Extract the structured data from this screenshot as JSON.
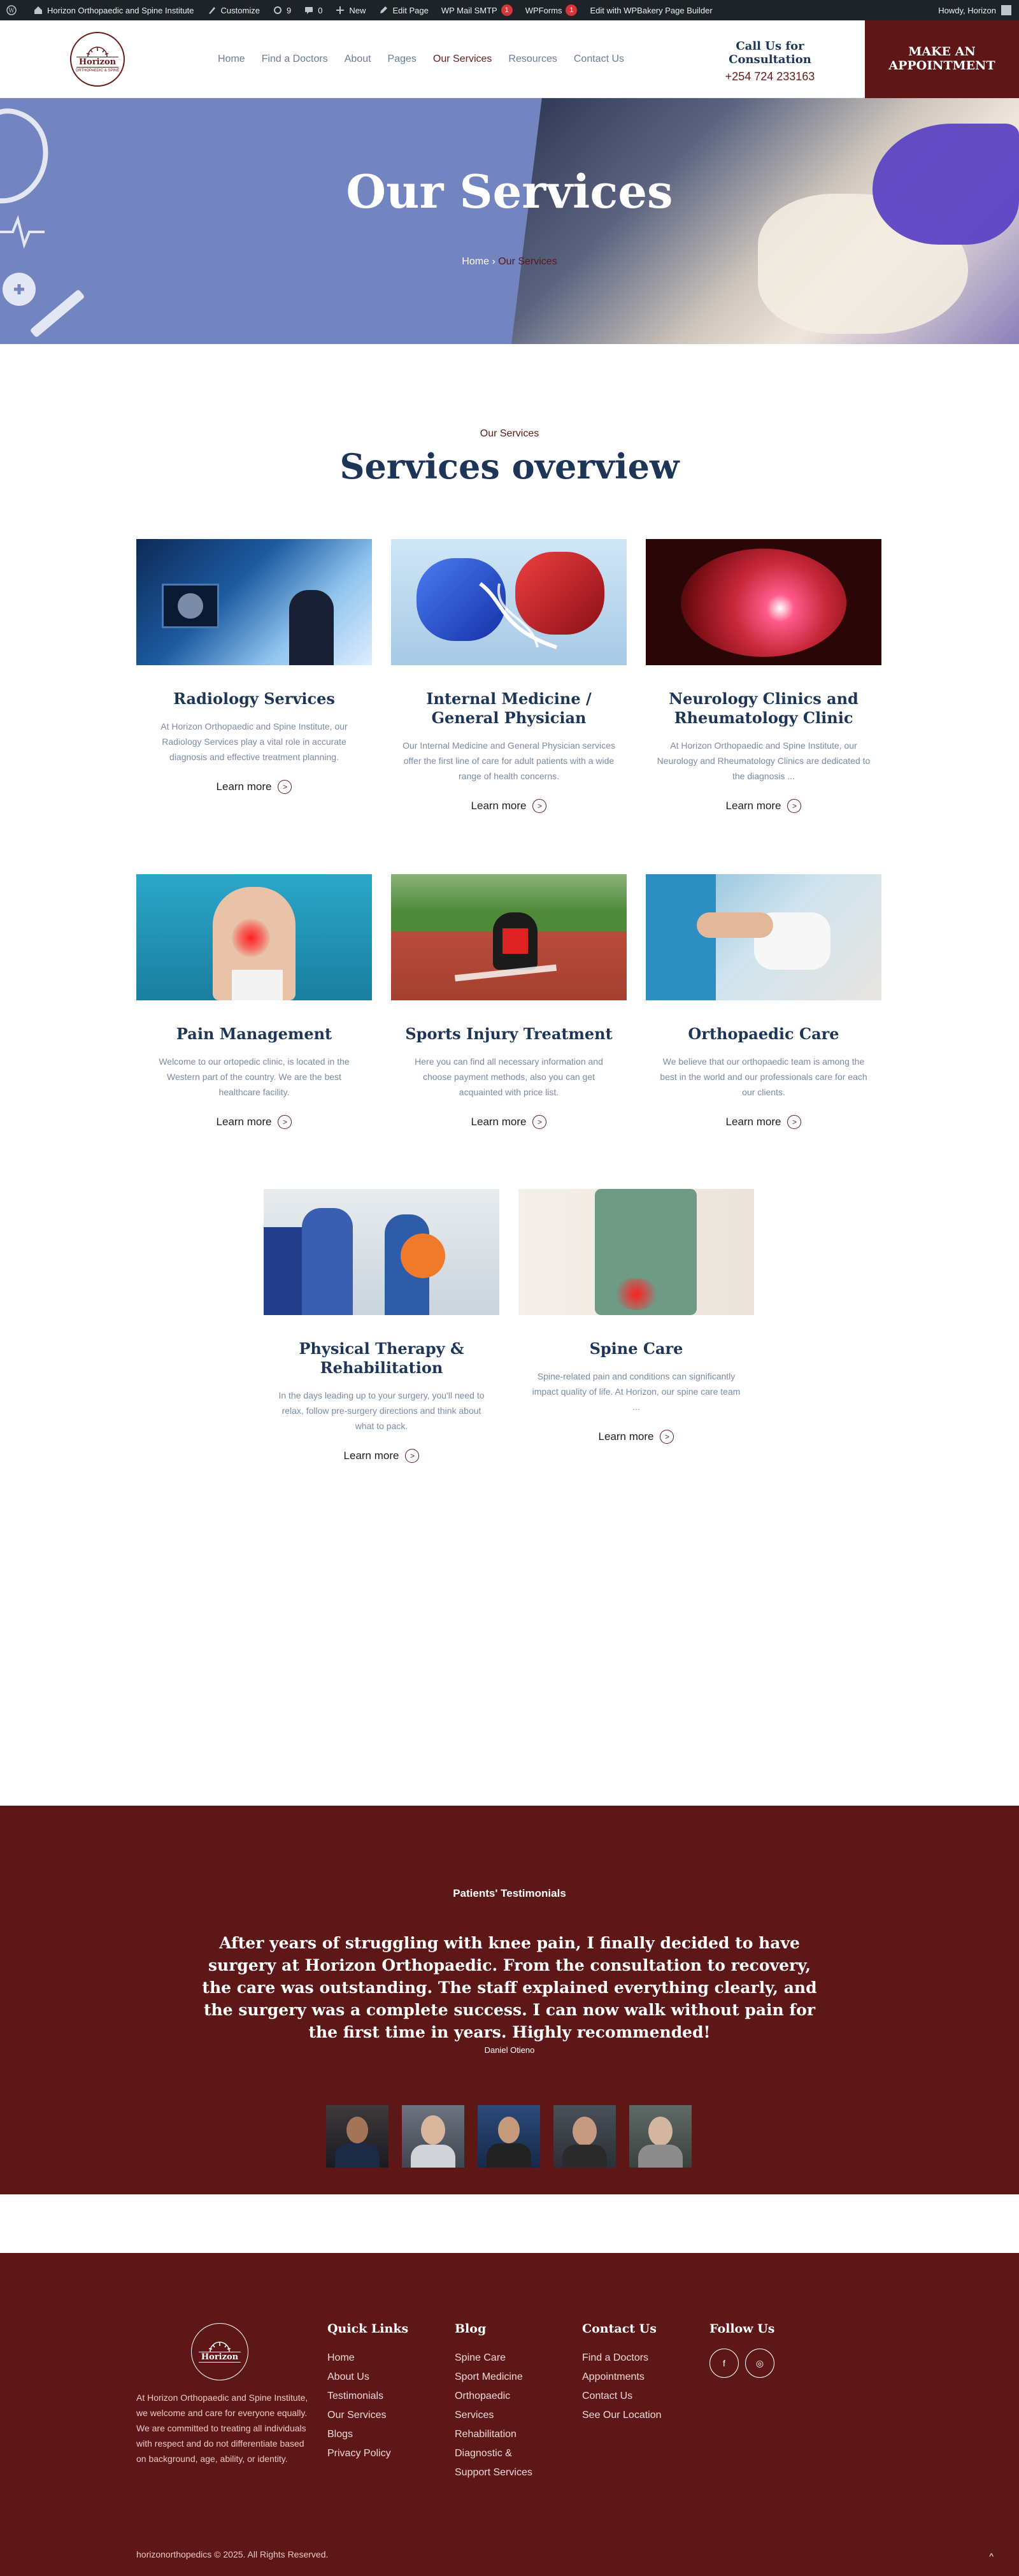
{
  "adminbar": {
    "site_name": "Horizon Orthopaedic and Spine Institute",
    "customize": "Customize",
    "updates_count": "9",
    "comments_count": "0",
    "new": "New",
    "edit_page": "Edit Page",
    "wp_mail_smtp": "WP Mail SMTP",
    "wp_mail_badge": "1",
    "wpforms": "WPForms",
    "wpforms_badge": "1",
    "wpbakery": "Edit with WPBakery Page Builder",
    "howdy": "Howdy, Horizon"
  },
  "header": {
    "logo_text": "Horizon",
    "logo_sub": "ORTHOPAEDIC & SPINE",
    "nav": [
      "Home",
      "Find a Doctors",
      "About",
      "Pages",
      "Our Services",
      "Resources",
      "Contact Us"
    ],
    "active_nav": "Our Services",
    "call_label": "Call Us for Consultation",
    "phone": "+254 724 233163",
    "appointment_btn": "MAKE AN APPOINTMENT"
  },
  "hero": {
    "title": "Our Services",
    "crumb_home": "Home",
    "crumb_sep": "›",
    "crumb_current": "Our Services"
  },
  "services": {
    "subtitle": "Our Services",
    "title": "Services overview",
    "learn_more": "Learn more",
    "items": [
      {
        "title": "Radiology Services",
        "text": "At Horizon Orthopaedic and Spine Institute, our Radiology Services play a vital role in accurate diagnosis and effective treatment planning."
      },
      {
        "title": "Internal Medicine / General Physician",
        "text": "Our Internal Medicine and General Physician services offer the first line of care for adult patients with a wide range of health concerns."
      },
      {
        "title": "Neurology Clinics and Rheumatology Clinic",
        "text": "At Horizon Orthopaedic and Spine Institute, our Neurology and Rheumatology Clinics are dedicated to the diagnosis ..."
      },
      {
        "title": "Pain Management",
        "text": "Welcome to our ortopedic clinic, is located in the Western part of the country. We are the best healthcare facility."
      },
      {
        "title": "Sports Injury Treatment",
        "text": "Here you can find all necessary information and choose payment methods, also you can get acquainted with price list."
      },
      {
        "title": "Orthopaedic Care",
        "text": "We believe that our orthopaedic team is among the best in the world and our professionals care for each our clients."
      },
      {
        "title": "Physical Therapy & Rehabilitation",
        "text": "In the days leading up to your surgery, you'll need to relax, follow pre-surgery directions and think about what to pack."
      },
      {
        "title": "Spine Care",
        "text": "Spine-related pain and conditions can significantly impact quality of life. At Horizon, our spine care team ..."
      }
    ]
  },
  "testimonials": {
    "label": "Patients' Testimonials",
    "quote": "After years of struggling with knee pain, I finally decided to have surgery at Horizon Orthopaedic. From the consultation to recovery, the care was outstanding. The staff explained everything clearly, and the surgery was a complete success. I can now walk without pain for the first time in years. Highly recommended!",
    "author": "Daniel Otieno"
  },
  "footer": {
    "logo_text": "Horizon",
    "about": "At Horizon Orthopaedic and Spine Institute, we welcome and care for everyone equally. We are committed to treating all individuals with respect and do not differentiate based on background, age, ability, or identity.",
    "quick_links_title": "Quick Links",
    "quick_links": [
      "Home",
      "About Us",
      "Testimonials",
      "Our Services",
      "Blogs",
      "Privacy Policy"
    ],
    "blog_title": "Blog",
    "blog_links": [
      "Spine Care",
      "Sport Medicine",
      "Orthopaedic",
      "Services",
      "Rehabilitation",
      "Diagnostic &",
      "Support Services"
    ],
    "contact_title": "Contact Us",
    "contact_links": [
      "Find a Doctors",
      "Appointments",
      "Contact Us",
      "See Our Location"
    ],
    "follow_title": "Follow Us",
    "social": [
      "f",
      "◎"
    ],
    "copyright": "horizonorthopedics © 2025. All Rights Reserved.",
    "to_top": "^"
  }
}
